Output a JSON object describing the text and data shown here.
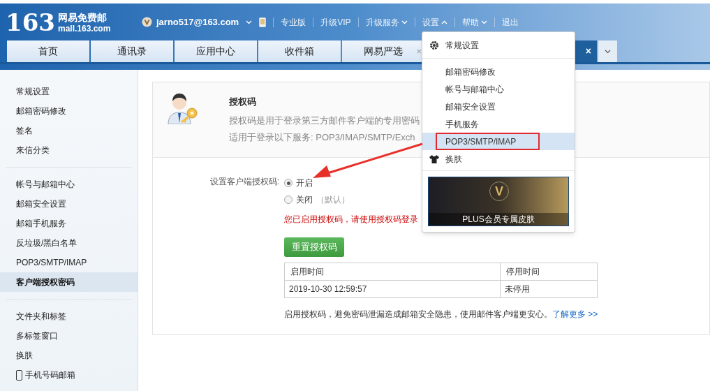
{
  "logo": {
    "number": "163",
    "name": "网易免费邮",
    "domain": "mall.163.com"
  },
  "account": {
    "email": "jarno517@163.com"
  },
  "nav_links": [
    {
      "label": "专业版"
    },
    {
      "label": "升级VIP"
    },
    {
      "label": "升级服务",
      "expanded": false
    },
    {
      "label": "设置",
      "expanded": true
    },
    {
      "label": "帮助",
      "expanded": false
    },
    {
      "label": "退出"
    }
  ],
  "tabs": [
    {
      "label": "首页",
      "selected": false
    },
    {
      "label": "通讯录",
      "selected": false
    },
    {
      "label": "应用中心",
      "selected": false
    },
    {
      "label": "收件箱",
      "selected": false
    },
    {
      "label": "网易严选",
      "selected": false,
      "close": "×"
    },
    {
      "selected": true,
      "close": "×"
    }
  ],
  "sidebar": {
    "groups": [
      [
        {
          "label": "常规设置",
          "selected": false
        },
        {
          "label": "邮箱密码修改",
          "selected": false
        },
        {
          "label": "签名",
          "selected": false
        },
        {
          "label": "来信分类",
          "selected": false
        }
      ],
      [
        {
          "label": "帐号与邮箱中心",
          "selected": false
        },
        {
          "label": "邮箱安全设置",
          "selected": false
        },
        {
          "label": "邮箱手机服务",
          "selected": false
        },
        {
          "label": "反垃圾/黑白名单",
          "selected": false
        },
        {
          "label": "POP3/SMTP/IMAP",
          "selected": false
        },
        {
          "label": "客户端授权密码",
          "selected": true
        }
      ],
      [
        {
          "label": "文件夹和标签",
          "selected": false
        },
        {
          "label": "多标签窗口",
          "selected": false
        },
        {
          "label": "换肤",
          "selected": false
        },
        {
          "label": "手机号码邮箱",
          "selected": false
        }
      ]
    ]
  },
  "panel": {
    "title": "授权码",
    "description": "授权码是用于登录第三方邮件客户端的专用密码",
    "services": "适用于登录以下服务: POP3/IMAP/SMTP/Exch",
    "setting_label": "设置客户端授权码:",
    "options": [
      {
        "label": "开启",
        "selected": true
      },
      {
        "label": "关闭",
        "note": "（默认）",
        "selected": false
      }
    ],
    "notice": "您已启用授权码，请使用授权码登录",
    "reset_button": "重置授权码",
    "table": {
      "columns": [
        "启用时间",
        "停用时间"
      ],
      "rows": [
        [
          "2019-10-30 12:59:57",
          "未停用"
        ]
      ]
    },
    "footer": "启用授权码，避免密码泄漏造成邮箱安全隐患，使用邮件客户端更安心。",
    "footer_link": "了解更多 >>"
  },
  "settings_menu": {
    "groups": [
      [
        {
          "label": "常规设置",
          "selected": false,
          "outlined": false
        }
      ],
      [
        {
          "label": "邮箱密码修改",
          "selected": false,
          "outlined": false
        },
        {
          "label": "帐号与邮箱中心",
          "selected": false,
          "outlined": false
        },
        {
          "label": "邮箱安全设置",
          "selected": false,
          "outlined": false
        },
        {
          "label": "手机服务",
          "selected": false,
          "outlined": false
        },
        {
          "label": "POP3/SMTP/IMAP",
          "selected": true,
          "outlined": true
        },
        {
          "label": "换肤",
          "selected": false,
          "outlined": false
        }
      ]
    ],
    "banner": {
      "badge": "V",
      "caption": "PLUS会员专属皮肤"
    }
  }
}
